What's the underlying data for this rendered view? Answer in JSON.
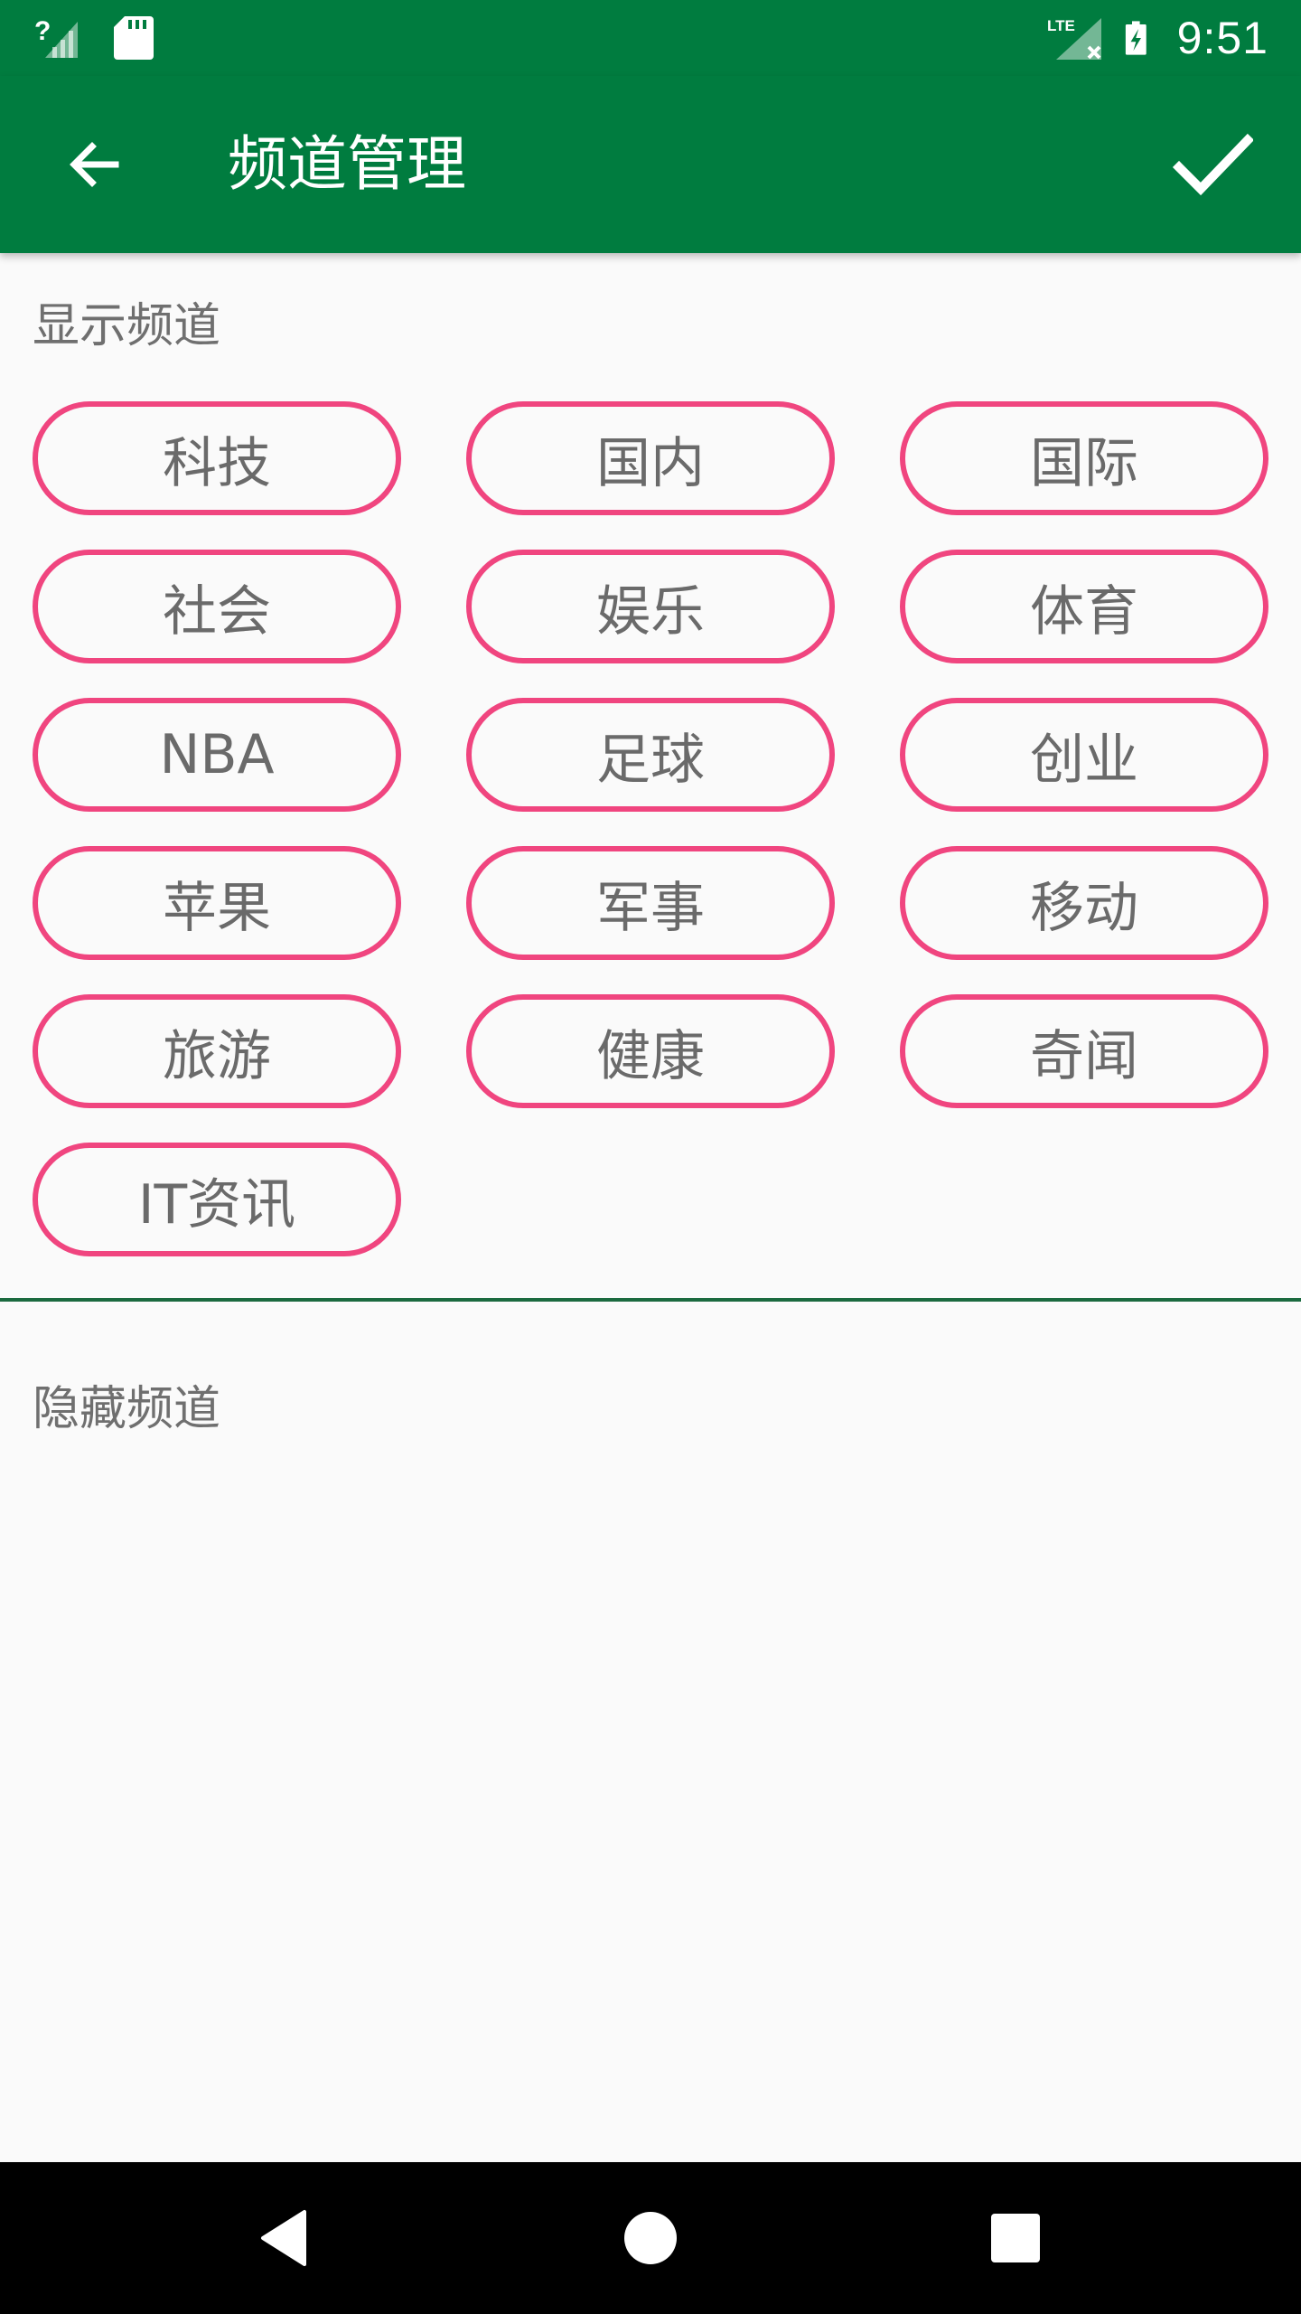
{
  "status_bar": {
    "time": "9:51",
    "network_label": "LTE",
    "icons": [
      "signal-unknown-icon",
      "sd-card-icon",
      "lte-signal-no-data-icon",
      "battery-charging-icon"
    ]
  },
  "app_bar": {
    "title": "频道管理",
    "back_icon": "arrow-left-icon",
    "confirm_icon": "check-icon"
  },
  "shown_section": {
    "label": "显示频道",
    "channels": [
      {
        "label": "科技"
      },
      {
        "label": "国内"
      },
      {
        "label": "国际"
      },
      {
        "label": "社会"
      },
      {
        "label": "娱乐"
      },
      {
        "label": "体育"
      },
      {
        "label": "NBA"
      },
      {
        "label": "足球"
      },
      {
        "label": "创业"
      },
      {
        "label": "苹果"
      },
      {
        "label": "军事"
      },
      {
        "label": "移动"
      },
      {
        "label": "旅游"
      },
      {
        "label": "健康"
      },
      {
        "label": "奇闻"
      },
      {
        "label": "IT资讯"
      }
    ]
  },
  "hidden_section": {
    "label": "隐藏频道",
    "channels": []
  },
  "colors": {
    "primary": "#007c3f",
    "chip_border": "#f0457f",
    "chip_text": "#6a6a6a",
    "section_label": "#6f6f6f",
    "background": "#fafafa",
    "divider": "#1b6a3f"
  },
  "nav_bar": {
    "icons": [
      "nav-back-triangle-icon",
      "nav-home-circle-icon",
      "nav-recents-square-icon"
    ]
  }
}
